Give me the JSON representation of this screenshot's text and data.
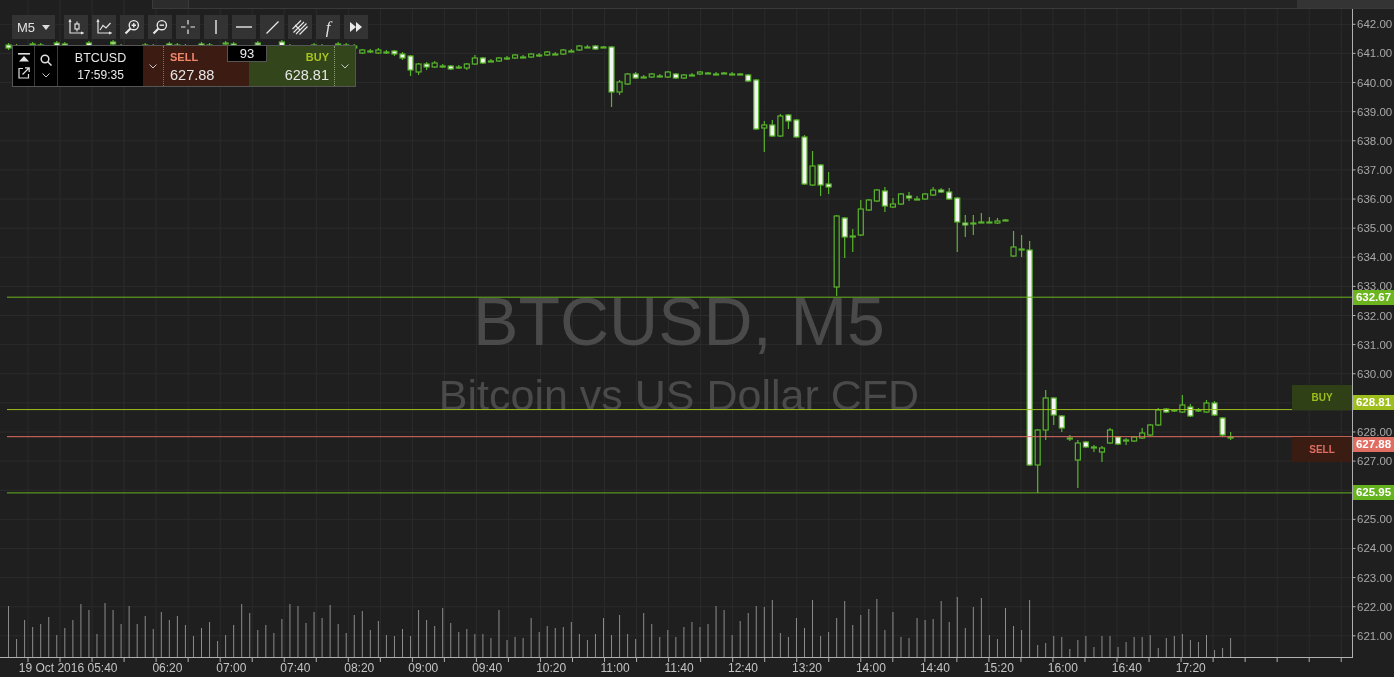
{
  "toolbar": {
    "timeframe": "M5",
    "function_label": "f"
  },
  "trade_panel": {
    "symbol": "BTCUSD",
    "time": "17:59:35",
    "sell": {
      "label": "SELL",
      "price": "627.88"
    },
    "spread": "93",
    "buy": {
      "label": "BUY",
      "price": "628.81"
    }
  },
  "chart": {
    "watermark": {
      "title": "BTCUSD, M5",
      "subtitle": "Bitcoin vs US Dollar CFD"
    },
    "price_axis": [
      "642.00",
      "641.00",
      "640.00",
      "639.00",
      "638.00",
      "637.00",
      "636.00",
      "635.00",
      "634.00",
      "633.00",
      "632.00",
      "631.00",
      "630.00",
      "628.00",
      "627.00",
      "625.00",
      "624.00",
      "623.00",
      "622.00",
      "621.00"
    ],
    "time_axis": [
      "19 Oct 2016 05:40",
      "06:20",
      "07:00",
      "07:40",
      "08:20",
      "09:00",
      "09:40",
      "10:20",
      "11:00",
      "11:40",
      "12:40",
      "13:20",
      "14:00",
      "14:40",
      "15:20",
      "16:00",
      "16:40",
      "17:20"
    ],
    "levels": [
      {
        "kind": "level",
        "price": "632.67",
        "color": "#6cb51f"
      },
      {
        "kind": "ask",
        "price": "628.81",
        "color": "#9dbe1d",
        "marker": "BUY"
      },
      {
        "kind": "bid",
        "price": "627.88",
        "color": "#e06d61",
        "marker": "SELL"
      },
      {
        "kind": "level",
        "price": "625.95",
        "color": "#64b31f"
      }
    ]
  }
}
